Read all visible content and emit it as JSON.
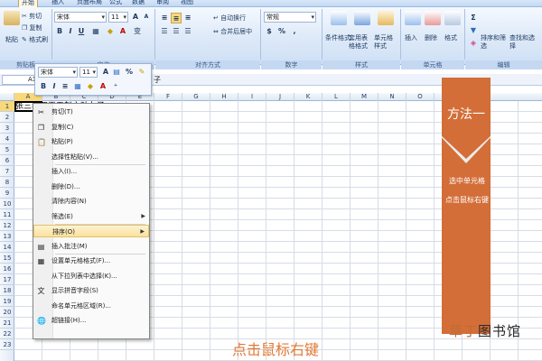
{
  "ribbon_tabs": [
    "开始",
    "插入",
    "页面布局",
    "公式",
    "数据",
    "审阅",
    "视图"
  ],
  "clipboard": {
    "paste": "粘贴",
    "cut": "剪切",
    "copy": "复制",
    "format_painter": "格式刷",
    "group": "剪贴板"
  },
  "font": {
    "name": "宋体",
    "size": "11",
    "bold": "B",
    "italic": "I",
    "underline": "U",
    "grow": "A",
    "shrink": "A",
    "color": "A",
    "phonetic": "变",
    "group": "字体"
  },
  "alignment": {
    "wrap": "自动换行",
    "merge": "合并后居中",
    "group": "对齐方式"
  },
  "number": {
    "format": "常规",
    "percent": "%",
    "comma": ",",
    "currency": "$",
    "group": "数字"
  },
  "styles": {
    "conditional": "条件格式",
    "table": "套用表格格式",
    "cell": "单元格样式",
    "group": "样式"
  },
  "cells": {
    "insert": "插入",
    "delete": "删除",
    "format": "格式",
    "group": "单元格"
  },
  "editing": {
    "sort": "排序和筛选",
    "find": "查找和选择",
    "group": "编辑"
  },
  "namebox": "A1",
  "formula": "子",
  "mini_toolbar": {
    "font": "宋体",
    "size": "11",
    "bold": "B",
    "italic": "I",
    "align": "≡"
  },
  "columns": [
    "A",
    "B",
    "C",
    "D",
    "E",
    "F",
    "G",
    "H",
    "I",
    "J",
    "K",
    "L",
    "M",
    "N",
    "O",
    "P"
  ],
  "rows": [
    "1",
    "2",
    "3",
    "4",
    "5",
    "6",
    "7",
    "8",
    "9",
    "10",
    "11",
    "12",
    "13",
    "14",
    "15",
    "16",
    "17",
    "18",
    "19",
    "20",
    "21",
    "22",
    "23"
  ],
  "cell_a1": "张三李四王五赵六孙七子",
  "context_menu": [
    {
      "label": "剪切(T)",
      "icon": "scissors-icon",
      "glyph": "✂"
    },
    {
      "label": "复制(C)",
      "icon": "copy-icon",
      "glyph": "❐"
    },
    {
      "label": "粘贴(P)",
      "icon": "paste-icon",
      "glyph": "📋"
    },
    {
      "label": "选择性粘贴(V)...",
      "icon": "",
      "glyph": ""
    },
    {
      "label": "插入(I)...",
      "icon": "",
      "glyph": ""
    },
    {
      "label": "删除(D)...",
      "icon": "",
      "glyph": ""
    },
    {
      "label": "清除内容(N)",
      "icon": "",
      "glyph": ""
    },
    {
      "label": "筛选(E)",
      "icon": "",
      "glyph": "",
      "submenu": true
    },
    {
      "label": "排序(O)",
      "icon": "",
      "glyph": "",
      "submenu": true,
      "highlighted": true
    },
    {
      "label": "插入批注(M)",
      "icon": "comment-icon",
      "glyph": "▤"
    },
    {
      "label": "设置单元格格式(F)...",
      "icon": "format-cells-icon",
      "glyph": "▦"
    },
    {
      "label": "从下拉列表中选择(K)...",
      "icon": "",
      "glyph": ""
    },
    {
      "label": "显示拼音字段(S)",
      "icon": "phonetic-icon",
      "glyph": "文"
    },
    {
      "label": "命名单元格区域(R)...",
      "icon": "",
      "glyph": ""
    },
    {
      "label": "超链接(H)...",
      "icon": "hyperlink-icon",
      "glyph": "🌐"
    }
  ],
  "banner": {
    "title": "方法一",
    "line1": "选中单元格",
    "line2": "点击鼠标右键"
  },
  "caption": "点击鼠标右键",
  "watermark": {
    "part1": "草丁",
    "part2": "图书馆"
  },
  "colors": {
    "accent_orange": "#d36e38",
    "caption_orange": "#e07a35",
    "ribbon_blue": "#dde9f8"
  }
}
